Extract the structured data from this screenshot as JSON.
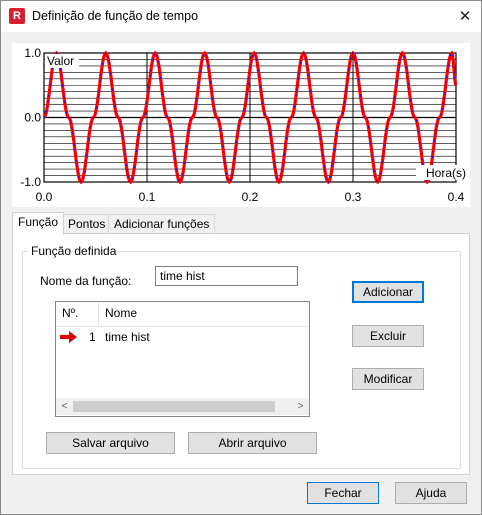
{
  "window": {
    "title": "Definição de função de tempo",
    "app_icon_letter": "R",
    "close_glyph": "✕"
  },
  "plot": {
    "ylabel": "Valor",
    "xlabel": "Hora(s)",
    "y_ticks": [
      "1.0",
      "0.0",
      "-1.0"
    ],
    "x_ticks": [
      "0.0",
      "0.1",
      "0.2",
      "0.3",
      "0.4"
    ],
    "series_color": "#ff0000",
    "points_color": "#0000ff",
    "chart_data": {
      "type": "line",
      "xlim": [
        0,
        0.4
      ],
      "ylim": [
        -1,
        1
      ],
      "grid": true,
      "series": [
        {
          "description": "sine wave, amplitude 1, period approx. 0.048 s",
          "x": [
            0,
            0.012,
            0.024,
            0.036,
            0.048,
            0.06,
            0.072,
            0.084,
            0.096,
            0.108,
            0.12,
            0.132,
            0.144,
            0.156,
            0.168,
            0.18,
            0.192,
            0.204,
            0.216,
            0.228,
            0.24,
            0.252,
            0.264,
            0.276,
            0.288,
            0.3,
            0.312,
            0.324,
            0.336,
            0.348,
            0.36,
            0.372,
            0.384,
            0.396,
            0.4
          ],
          "y": [
            0,
            1,
            0,
            -1,
            0,
            1,
            0,
            -1,
            0,
            1,
            0,
            -1,
            0,
            1,
            0,
            -1,
            0,
            1,
            0,
            -1,
            0,
            1,
            0,
            -1,
            0,
            1,
            0,
            -1,
            0,
            1,
            0,
            -1,
            0,
            1,
            0.5
          ]
        }
      ]
    }
  },
  "tabs": [
    {
      "label": "Função",
      "active": true
    },
    {
      "label": "Pontos",
      "active": false
    },
    {
      "label": "Adicionar funções",
      "active": false
    }
  ],
  "group": {
    "title": "Função definida",
    "name_label": "Nome da função:",
    "name_value": "time hist",
    "list": {
      "col_number": "Nº.",
      "col_name": "Nome",
      "rows": [
        {
          "number": "1",
          "name": "time hist",
          "selected_arrow": true
        }
      ]
    },
    "scroll_left": "<",
    "scroll_right": ">",
    "buttons": {
      "add": "Adicionar",
      "delete": "Excluir",
      "modify": "Modificar",
      "save_file": "Salvar arquivo",
      "open_file": "Abrir arquivo"
    }
  },
  "footer": {
    "close": "Fechar",
    "help": "Ajuda"
  }
}
